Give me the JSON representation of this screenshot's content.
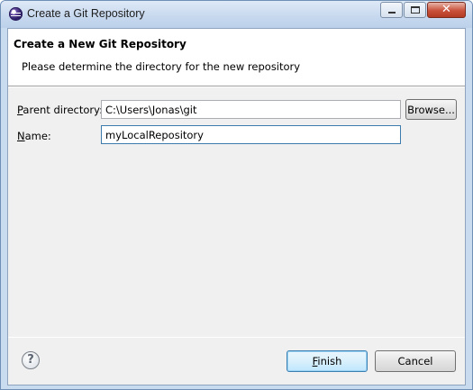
{
  "window": {
    "title": "Create a Git Repository"
  },
  "banner": {
    "title": "Create a New Git Repository",
    "description": "Please determine the directory for the new repository"
  },
  "form": {
    "parent_directory": {
      "label_mnemonic": "P",
      "label_rest": "arent directory:",
      "value": "C:\\Users\\Jonas\\git"
    },
    "name": {
      "label_mnemonic": "N",
      "label_rest": "ame:",
      "value": "myLocalRepository"
    },
    "browse_label": "Browse..."
  },
  "footer": {
    "help_glyph": "?",
    "finish_mnemonic": "F",
    "finish_rest": "inish",
    "cancel_label": "Cancel"
  },
  "icons": {
    "app": "eclipse-icon",
    "help": "help-icon",
    "minimize": "minimize-icon",
    "maximize": "maximize-icon",
    "close": "close-icon"
  }
}
